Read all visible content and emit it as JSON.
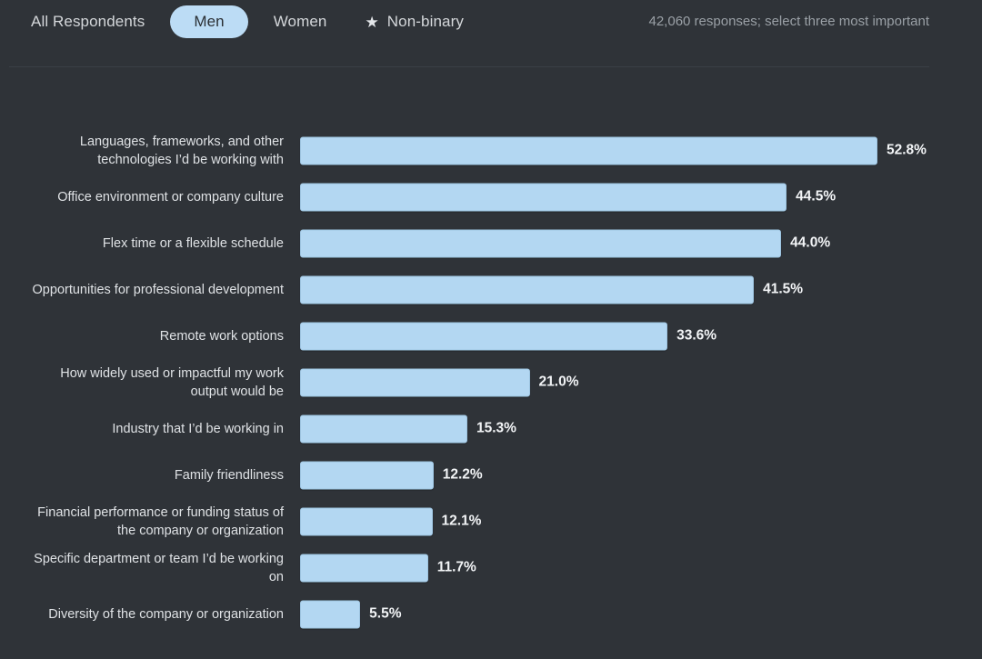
{
  "tabs": [
    {
      "label": "All Respondents",
      "active": false,
      "icon": null
    },
    {
      "label": "Men",
      "active": true,
      "icon": null
    },
    {
      "label": "Women",
      "active": false,
      "icon": null
    },
    {
      "label": "Non-binary",
      "active": false,
      "icon": "star-icon"
    }
  ],
  "header": {
    "responses_note": "42,060 responses; select three most important"
  },
  "colors": {
    "background": "#2f3338",
    "bar_fill": "#b3d7f2",
    "bar_border": "#9dc4e0",
    "active_tab_bg": "#bcdcf5",
    "active_tab_text": "#2b2f34",
    "tab_text": "#d4d7da",
    "note_text": "#9aa0a6",
    "label_text": "#dfe2e5",
    "value_text": "#f2f4f6",
    "divider": "#3a3f45"
  },
  "chart_data": {
    "type": "bar",
    "orientation": "horizontal",
    "title": "",
    "subtitle": "",
    "xlabel": "",
    "ylabel": "",
    "grid": false,
    "legend": null,
    "xlim": [
      0,
      52.8
    ],
    "value_suffix": "%",
    "categories": [
      "Languages, frameworks, and other technologies I’d be working with",
      "Office environment or company culture",
      "Flex time or a flexible schedule",
      "Opportunities for professional development",
      "Remote work options",
      "How widely used or impactful my work output would be",
      "Industry that I’d be working in",
      "Family friendliness",
      "Financial performance or funding status of the company or organization",
      "Specific department or team I’d be working on",
      "Diversity of the company or organization"
    ],
    "values": [
      52.8,
      44.5,
      44.0,
      41.5,
      33.6,
      21.0,
      15.3,
      12.2,
      12.1,
      11.7,
      5.5
    ],
    "value_labels": [
      "52.8%",
      "44.5%",
      "44.0%",
      "41.5%",
      "33.6%",
      "21.0%",
      "15.3%",
      "12.2%",
      "12.1%",
      "11.7%",
      "5.5%"
    ]
  }
}
